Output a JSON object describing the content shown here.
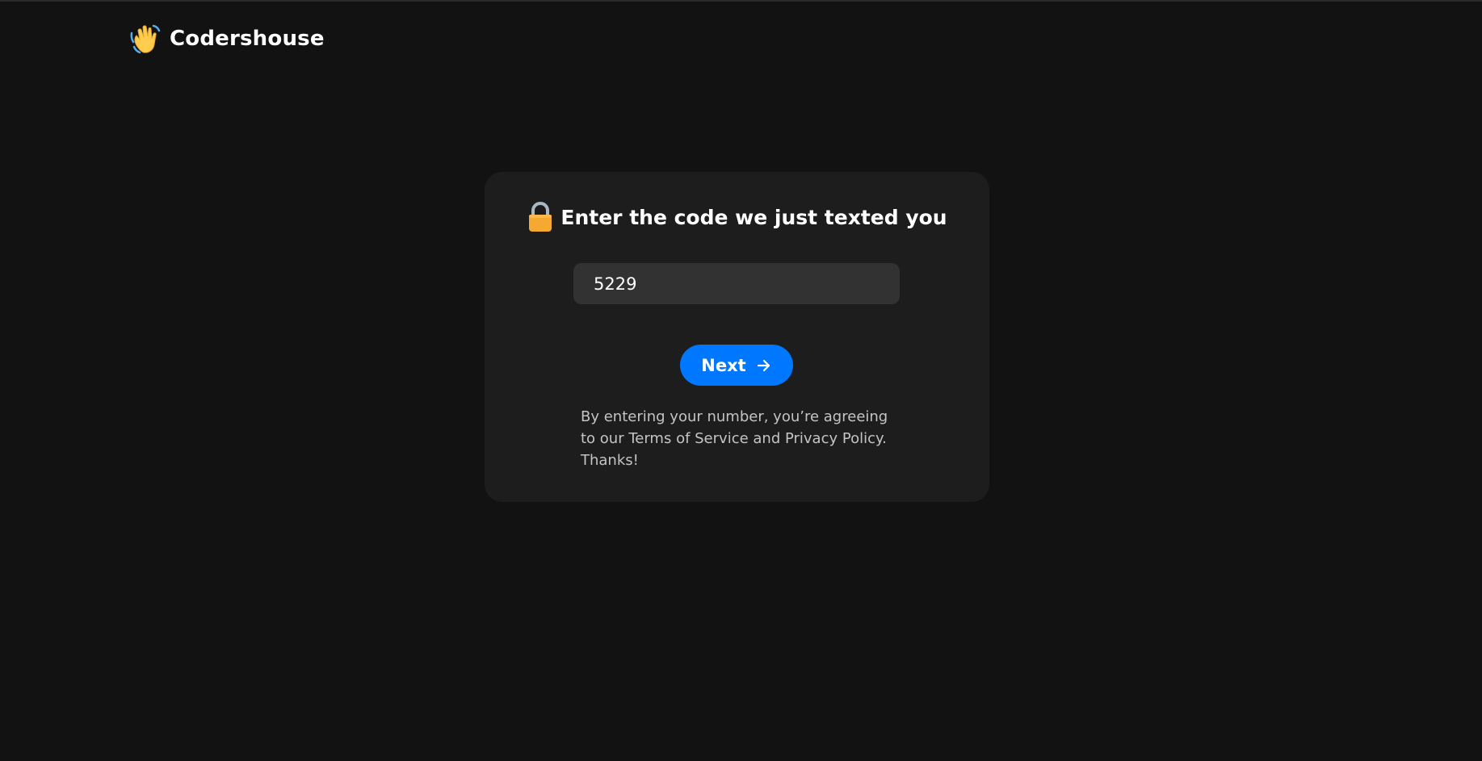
{
  "navbar": {
    "logo_icon": "waving-hand-icon",
    "brand": "Codershouse"
  },
  "card": {
    "heading_icon": "lock-icon",
    "heading": "Enter the code we just texted you",
    "code_input": {
      "value": "5229",
      "placeholder": ""
    },
    "next_button": {
      "label": "Next",
      "icon": "arrow-right-icon"
    },
    "terms_text": "By entering your number, you’re agreeing to our Terms of Service and Privacy Policy. Thanks!"
  },
  "colors": {
    "background": "#121212",
    "card": "#1d1d1d",
    "input": "#323232",
    "accent": "#0077ff",
    "lock": "#f6a930"
  }
}
